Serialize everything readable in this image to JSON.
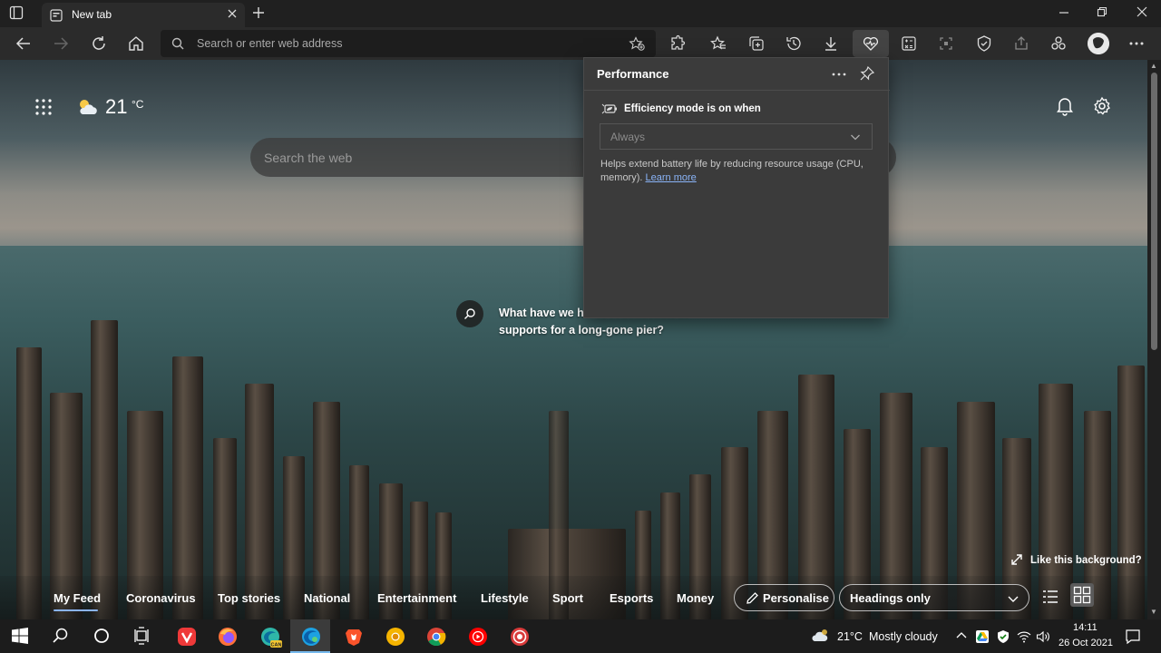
{
  "browser": {
    "tab": {
      "title": "New tab"
    },
    "address_bar": {
      "placeholder": "Search or enter web address"
    },
    "toolbar_icons": [
      "back-icon",
      "forward-icon",
      "refresh-icon",
      "home-icon",
      "extensions-icon",
      "favorites-icon",
      "collections-icon",
      "history-icon",
      "downloads-icon",
      "performance-icon",
      "math-solver-icon",
      "web-capture-icon",
      "browser-essentials-icon",
      "share-icon",
      "games-icon",
      "profile-avatar",
      "more-icon"
    ]
  },
  "new_tab_page": {
    "weather": {
      "temp": "21",
      "unit": "°C"
    },
    "search": {
      "placeholder": "Search the web"
    },
    "image_caption": "What have we here? A collection of supports for a long-gone pier?",
    "like_background": "Like this background?",
    "feed_tabs": [
      "My Feed",
      "Coronavirus",
      "Top stories",
      "National",
      "Entertainment",
      "Lifestyle",
      "Sport",
      "Esports",
      "Money"
    ],
    "personalise_label": "Personalise",
    "headings_select": {
      "selected": "Headings only"
    }
  },
  "performance_panel": {
    "title": "Performance",
    "efficiency_label": "Efficiency mode is on when",
    "efficiency_value": "Always",
    "help_text": "Helps extend battery life by reducing resource usage (CPU, memory).",
    "learn_more": "Learn more"
  },
  "taskbar": {
    "weather_temp": "21°C",
    "weather_desc": "Mostly cloudy",
    "clock_time": "14:11",
    "clock_date": "26 Oct 2021"
  },
  "colors": {
    "accent": "#8ab4f8",
    "panel_bg": "#3b3b3b",
    "toolbar_bg": "#2b2b2b"
  }
}
